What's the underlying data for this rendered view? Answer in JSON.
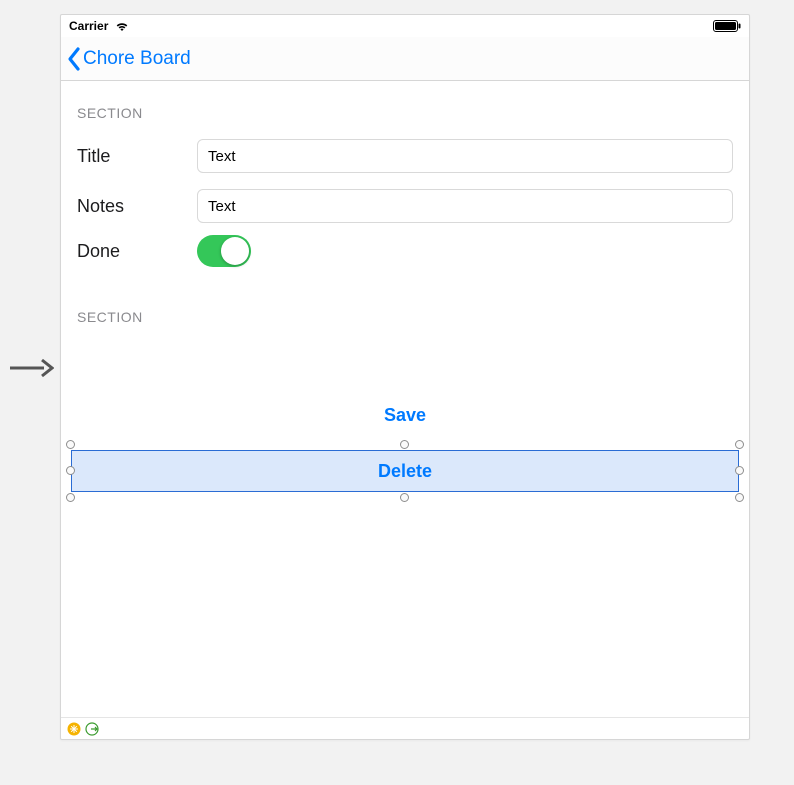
{
  "statusbar": {
    "carrier": "Carrier"
  },
  "navbar": {
    "back_label": "Chore Board"
  },
  "section1": {
    "header": "Section",
    "title_label": "Title",
    "title_value": "Text",
    "notes_label": "Notes",
    "notes_value": "Text",
    "done_label": "Done",
    "done_state": true
  },
  "section2": {
    "header": "Section",
    "save_label": "Save",
    "delete_label": "Delete"
  },
  "colors": {
    "tint": "#007aff",
    "switch_on": "#34c759",
    "selection_fill": "#dbe8fb",
    "selection_border": "#2a6cd4"
  }
}
